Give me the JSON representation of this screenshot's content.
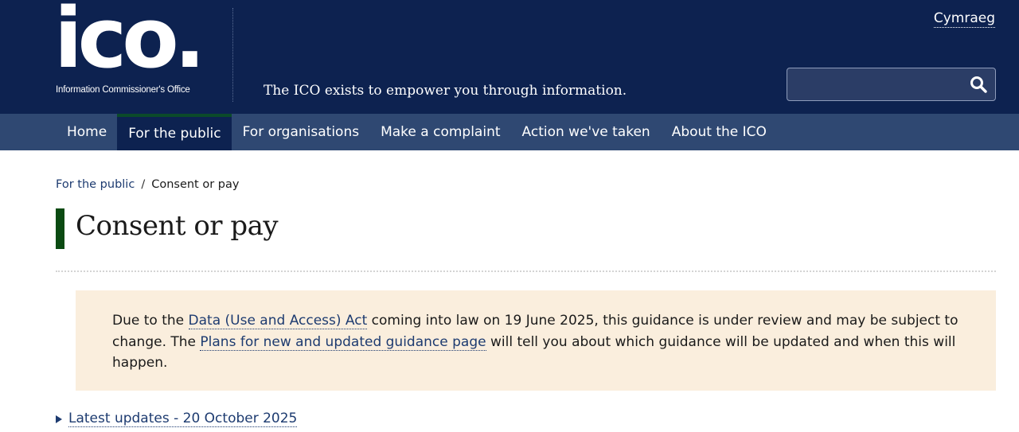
{
  "header": {
    "logo_mark": "ico.",
    "logo_subtitle": "Information Commissioner's Office",
    "tagline": "The ICO exists to empower you through information.",
    "language_link": "Cymraeg",
    "search": {
      "value": "",
      "placeholder": "",
      "icon": "search-icon"
    }
  },
  "nav": {
    "items": [
      {
        "label": "Home"
      },
      {
        "label": "For the public"
      },
      {
        "label": "For organisations"
      },
      {
        "label": "Make a complaint"
      },
      {
        "label": "Action we've taken"
      },
      {
        "label": "About the ICO"
      }
    ],
    "active_index": 1
  },
  "breadcrumb": {
    "parent": "For the public",
    "separator": "/",
    "current": "Consent or pay"
  },
  "page": {
    "title": "Consent or pay"
  },
  "notice": {
    "text_1": "Due to the ",
    "link_1": "Data (Use and Access) Act",
    "text_2": " coming into law on 19 June 2025, this guidance is under review and may be subject to change. The ",
    "link_2": "Plans for new and updated guidance page",
    "text_3": " will tell you about which guidance will be updated and when this will happen."
  },
  "updates": {
    "label": "Latest updates - 20 October 2025"
  },
  "colors": {
    "masthead": "#0d2250",
    "nav": "#2f4872",
    "nav_active": "#0d2250",
    "title_accent": "#0b4a12",
    "notice_bg": "#faeedd",
    "link": "#1d3b70"
  }
}
